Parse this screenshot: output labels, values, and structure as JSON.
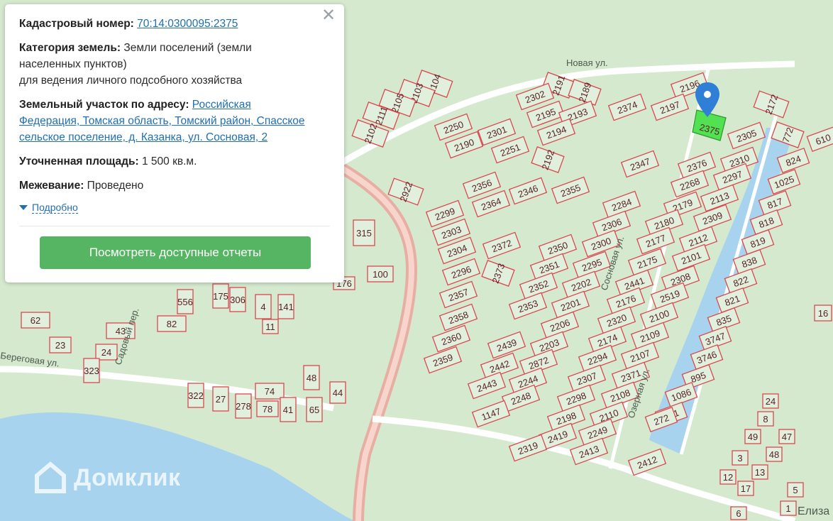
{
  "panel": {
    "cadastral_label": "Кадастровый номер:",
    "cadastral_value": "70:14:0300095:2375",
    "category_label": "Категория земель:",
    "category_value_line1": "Земли поселений (земли",
    "category_value_line2": "населенных пунктов)",
    "category_value_line3": "для ведения личного подсобного хозяйства",
    "address_label": "Земельный участок по адресу:",
    "address_value_part1": "Российская",
    "address_value_part2": "Федерация, Томская область, Томский район, Спасское",
    "address_value_part3": "сельское поселение, д. Казанка, ул. Сосновая, 2",
    "area_label": "Уточненная площадь:",
    "area_value": "1 500 кв.м.",
    "survey_label": "Межевание:",
    "survey_value": "Проведено",
    "details_link": "Подробно",
    "reports_button": "Посмотреть доступные отчеты",
    "close_icon": "close-icon"
  },
  "map": {
    "streets": [
      "Новая ул.",
      "Сосновая ул.",
      "Озерная ул.",
      "Садовый пер.",
      "Береговая ул.",
      "Елиза"
    ],
    "selected_parcel": "2375",
    "marker_icon": "map-pin-icon",
    "parcels": [
      "2104",
      "2103",
      "2105",
      "2111",
      "2102",
      "2191",
      "2189",
      "2302",
      "2195",
      "2193",
      "2194",
      "2192",
      "2374",
      "2196",
      "2197",
      "2172",
      "2305",
      "2310",
      "2297",
      "2376",
      "2268",
      "2113",
      "2179",
      "2309",
      "2180",
      "2112",
      "2177",
      "2101",
      "2175",
      "2308",
      "2441",
      "2519",
      "2176",
      "2100",
      "2320",
      "2109",
      "2174",
      "2107",
      "2294",
      "2371",
      "2307",
      "2108",
      "2298",
      "2110",
      "2198",
      "2249",
      "2419",
      "2413",
      "2412",
      "2250",
      "2190",
      "2301",
      "2251",
      "2356",
      "2346",
      "2364",
      "2299",
      "2303",
      "2304",
      "2296",
      "2357",
      "2358",
      "2360",
      "2359",
      "2372",
      "2373",
      "2355",
      "2284",
      "2306",
      "2300",
      "2350",
      "2295",
      "2351",
      "2202",
      "2352",
      "2201",
      "2353",
      "2206",
      "2203",
      "2439",
      "2872",
      "2442",
      "2244",
      "2443",
      "2248",
      "1147",
      "2319",
      "2347",
      "2922",
      "772",
      "610",
      "824",
      "1025",
      "817",
      "818",
      "819",
      "838",
      "822",
      "821",
      "835",
      "3747",
      "3746",
      "895",
      "1086",
      "891",
      "272",
      "315",
      "100",
      "556",
      "175",
      "306",
      "141",
      "62",
      "43",
      "82",
      "23",
      "24",
      "323",
      "322",
      "27",
      "278",
      "74",
      "78",
      "41",
      "48",
      "65",
      "44",
      "16",
      "11",
      "24",
      "8",
      "49",
      "47",
      "3",
      "48",
      "12",
      "13",
      "17",
      "5",
      "6",
      "1",
      "176",
      "4"
    ],
    "brand": "Домклик"
  }
}
